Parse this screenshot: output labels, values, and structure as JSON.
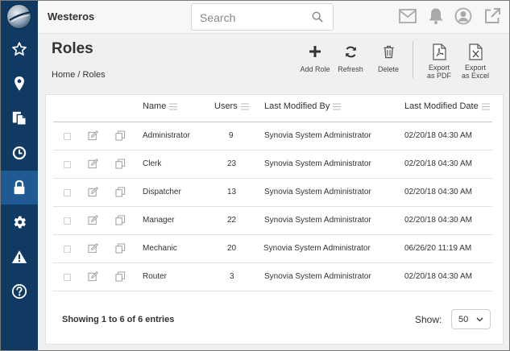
{
  "app": {
    "title": "Westeros"
  },
  "search": {
    "placeholder": "Search"
  },
  "sidebar": {
    "items": [
      {
        "name": "favorites",
        "icon": "star-icon"
      },
      {
        "name": "locations",
        "icon": "map-pin-icon"
      },
      {
        "name": "documents",
        "icon": "documents-icon"
      },
      {
        "name": "history",
        "icon": "clock-icon"
      },
      {
        "name": "security",
        "icon": "lock-icon",
        "active": true
      },
      {
        "name": "settings",
        "icon": "gear-icon"
      },
      {
        "name": "alerts",
        "icon": "warning-icon"
      },
      {
        "name": "help",
        "icon": "help-icon"
      }
    ]
  },
  "header_icons": [
    "mail-icon",
    "bell-icon",
    "user-icon",
    "external-link-icon"
  ],
  "page": {
    "title": "Roles",
    "breadcrumb": {
      "home": "Home",
      "separator": "/",
      "current": "Roles"
    }
  },
  "toolbar": {
    "add_line1": "Add Role",
    "refresh_line1": "Refresh",
    "delete_line1": "Delete",
    "pdf_line1": "Export",
    "pdf_line2": "as PDF",
    "excel_line1": "Export",
    "excel_line2": "as Excel"
  },
  "table": {
    "columns": {
      "name": "Name",
      "users": "Users",
      "modified_by": "Last Modified By",
      "modified_date": "Last Modified Date"
    },
    "rows": [
      {
        "name": "Administrator",
        "users": "9",
        "modified_by": "Synovia System Administrator",
        "modified_date": "02/20/18 04:30 AM"
      },
      {
        "name": "Clerk",
        "users": "23",
        "modified_by": "Synovia System Administrator",
        "modified_date": "02/20/18 04:30 AM"
      },
      {
        "name": "Dispatcher",
        "users": "13",
        "modified_by": "Synovia System Administrator",
        "modified_date": "02/20/18 04:30 AM"
      },
      {
        "name": "Manager",
        "users": "22",
        "modified_by": "Synovia System Administrator",
        "modified_date": "02/20/18 04:30 AM"
      },
      {
        "name": "Mechanic",
        "users": "20",
        "modified_by": "Synovia System Administrator",
        "modified_date": "06/26/20 11:19 AM"
      },
      {
        "name": "Router",
        "users": "3",
        "modified_by": "Synovia System Administrator",
        "modified_date": "02/20/18 04:30 AM"
      }
    ]
  },
  "footer": {
    "info": "Showing 1 to 6 of 6 entries",
    "show_label": "Show:",
    "page_size": "50"
  },
  "colors": {
    "sidebar": "#103a62",
    "sidebar_active": "#1f5a92",
    "header_icon": "#a9a9a9"
  }
}
